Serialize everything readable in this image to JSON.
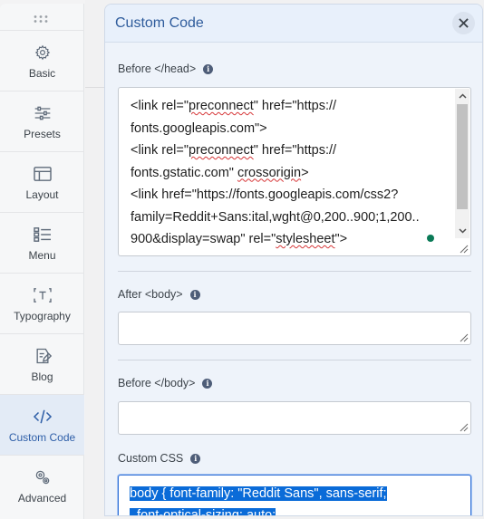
{
  "sidebar": {
    "items": [
      {
        "label": "Basic",
        "icon": "gear-icon"
      },
      {
        "label": "Presets",
        "icon": "sliders-icon"
      },
      {
        "label": "Layout",
        "icon": "layout-icon"
      },
      {
        "label": "Menu",
        "icon": "menu-list-icon"
      },
      {
        "label": "Typography",
        "icon": "typography-icon"
      },
      {
        "label": "Blog",
        "icon": "blog-edit-icon"
      },
      {
        "label": "Custom Code",
        "icon": "code-icon",
        "active": true
      },
      {
        "label": "Advanced",
        "icon": "advanced-gears-icon"
      }
    ]
  },
  "dialog": {
    "title": "Custom Code",
    "close_icon": "close-icon",
    "before_head": {
      "label": "Before </head>",
      "code": {
        "line1_a": "<link rel=\"",
        "line1_sq": "preconnect",
        "line1_b": "\" href=\"https://",
        "line2": "fonts.googleapis.com\">",
        "line3_a": "<link rel=\"",
        "line3_sq": "preconnect",
        "line3_b": "\" href=\"https://",
        "line4_a": "fonts.gstatic.com\" ",
        "line4_sq": "crossorigin",
        "line4_b": ">",
        "line5": "<link href=\"https://fonts.googleapis.com/css2?",
        "line6": "family=Reddit+Sans:ital,wght@0,200..900;1,200..",
        "line7_a": "900&display=swap\" rel=\"",
        "line7_sq": "stylesheet",
        "line7_b": "\">"
      }
    },
    "after_body": {
      "label": "After <body>",
      "value": ""
    },
    "before_body_end": {
      "label": "Before </body>",
      "value": ""
    },
    "custom_css": {
      "label": "Custom CSS",
      "line1": "body {  font-family: \"Reddit Sans\", sans-serif;",
      "line2": "  font-optical-sizing: auto;"
    }
  },
  "colors": {
    "accent": "#2f5c9c",
    "active_bg": "#e3ebf6",
    "selection": "#0a6bd8"
  }
}
